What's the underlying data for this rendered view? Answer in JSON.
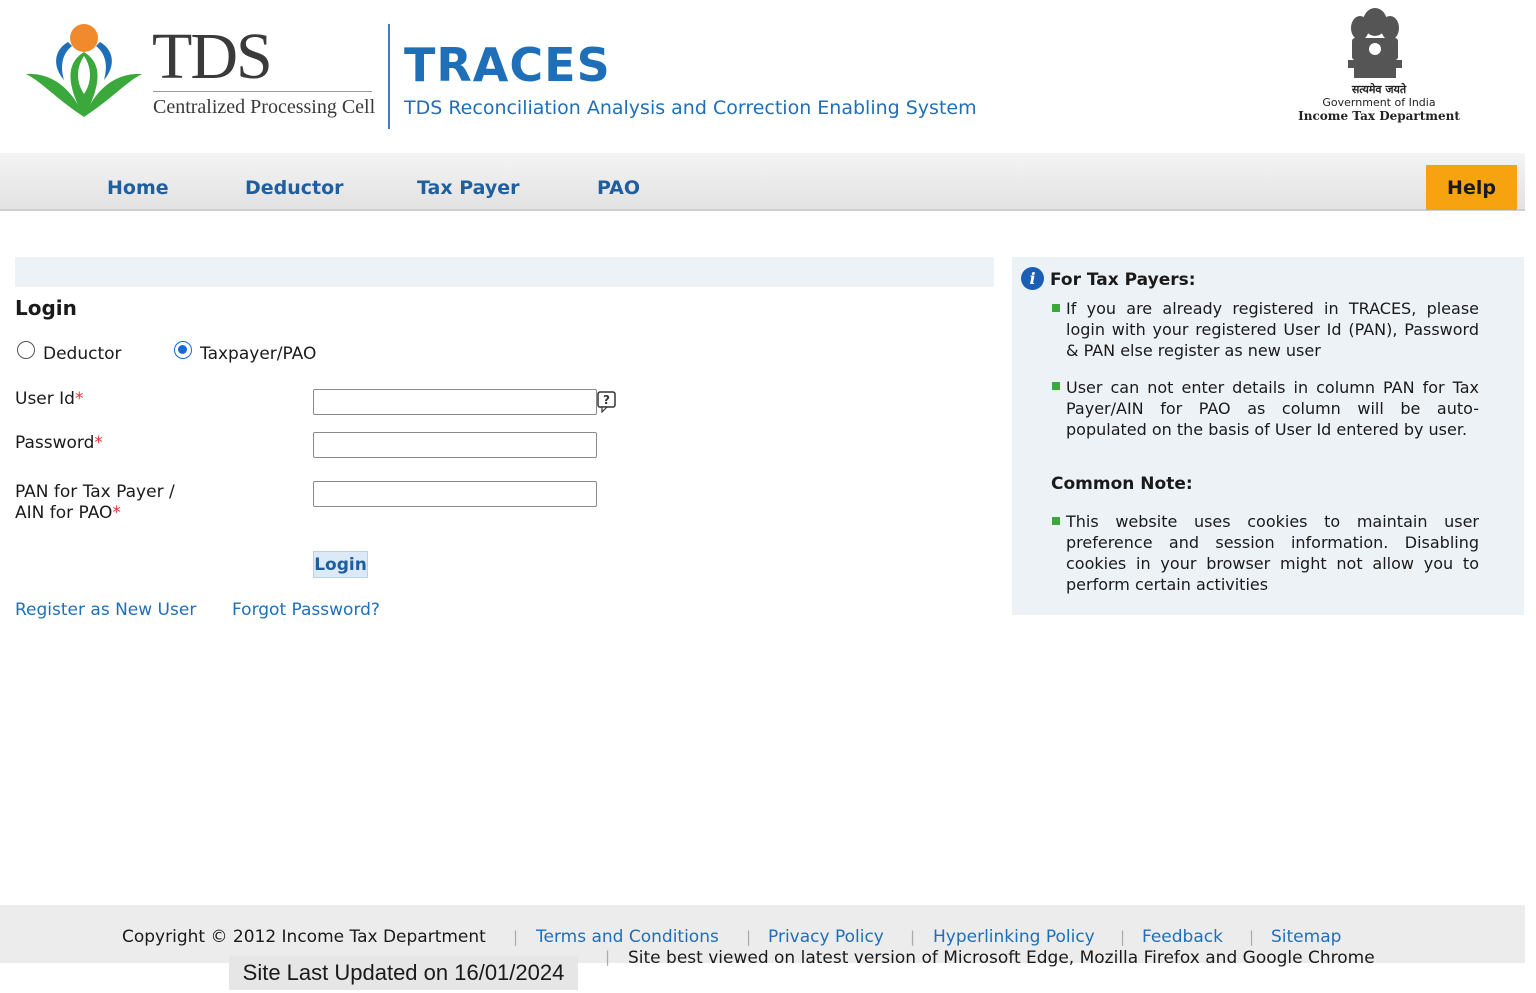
{
  "header": {
    "tds_text": "TDS",
    "tds_sub": "Centralized Processing Cell",
    "traces_title": "TRACES",
    "traces_sub": "TDS Reconciliation Analysis and Correction Enabling System",
    "gov_hindi": "सत्यमेव जयते",
    "gov_en": "Government of India",
    "itd": "Income Tax Department"
  },
  "nav": {
    "items": [
      "Home",
      "Deductor",
      "Tax Payer",
      "PAO"
    ],
    "help": "Help"
  },
  "login": {
    "title": "Login",
    "radio_deductor": "Deductor",
    "radio_taxpayer": "Taxpayer/PAO",
    "selected": "Taxpayer/PAO",
    "user_id_label": "User Id",
    "password_label": "Password",
    "pan_label_1": "PAN for Tax Payer /",
    "pan_label_2": "AIN for PAO",
    "required_mark": "*",
    "user_id_value": "",
    "password_value": "",
    "pan_value": "",
    "help_icon": "question-icon",
    "button": "Login",
    "register_link": "Register as New User",
    "forgot_link": "Forgot Password?"
  },
  "info": {
    "icon": "info-icon",
    "heading": "For Tax Payers:",
    "bullets": [
      "If you are already registered in TRACES, please login with your registered User Id (PAN), Password & PAN else register as new user",
      "User can not enter details in column PAN for Tax Payer/AIN for PAO as column will be auto-populated on the basis of User Id entered by user."
    ],
    "note_heading": "Common Note:",
    "note_bullet": "This website uses cookies to maintain user preference and session information. Disabling cookies in your browser might not allow you to perform certain activities"
  },
  "footer": {
    "copyright": "Copyright © 2012 Income Tax Department",
    "links": [
      "Terms and Conditions",
      "Privacy Policy",
      "Hyperlinking Policy",
      "Feedback",
      "Sitemap"
    ],
    "separator": "|",
    "updated": "Site Last Updated on 16/01/2024",
    "best_viewed": "Site best viewed on latest version of Microsoft Edge, Mozilla Firefox and Google Chrome"
  },
  "colors": {
    "brand_blue": "#1f6fb8",
    "help_orange": "#f7a20f",
    "bullet_green": "#3aa83a",
    "required_red": "#e0342d",
    "panel_bg": "#edf2f7"
  }
}
